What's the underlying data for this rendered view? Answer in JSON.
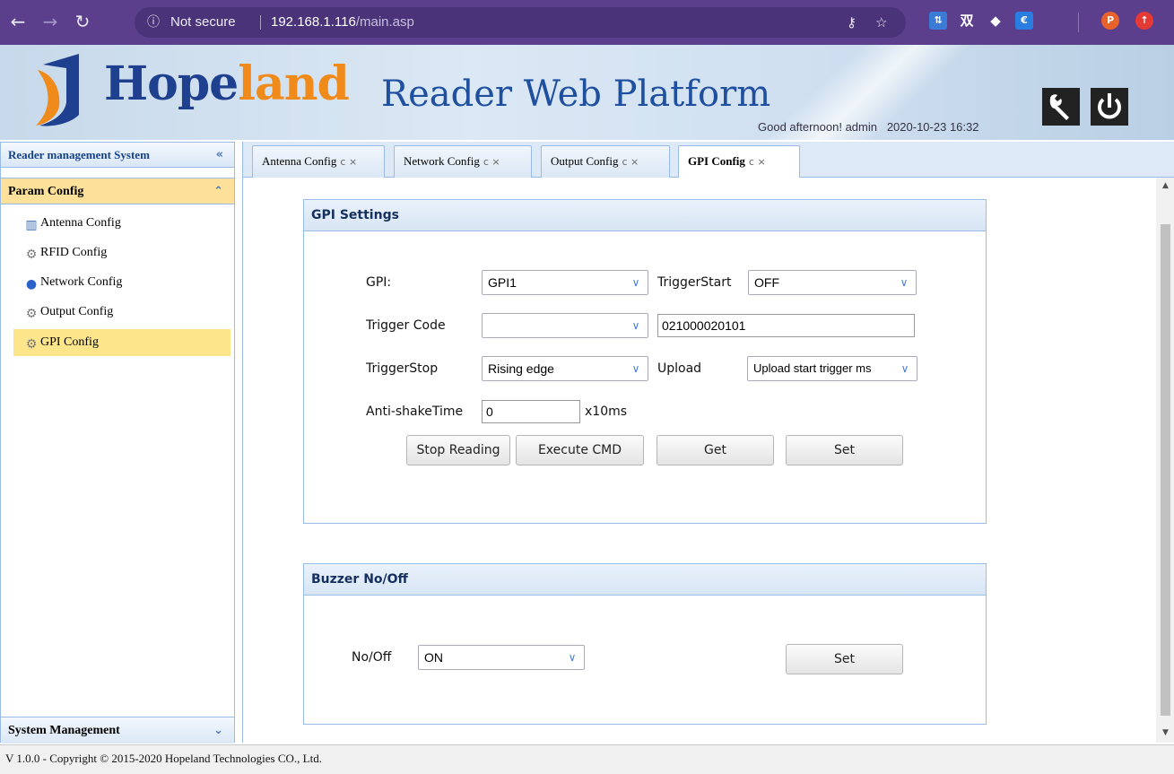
{
  "browser": {
    "info_icon": "ⓘ",
    "security_label": "Not secure",
    "url_host": "192.168.1.116",
    "url_path": "/main.asp",
    "extensions": [
      "P"
    ]
  },
  "header": {
    "logo_part1": "Hope",
    "logo_part2": "land",
    "title": "Reader Web Platform",
    "greeting": "Good afternoon! admin",
    "datetime": "2020-10-23 16:32",
    "settings_icon": "wrench-icon",
    "power_icon": "power-icon"
  },
  "sidebar": {
    "title": "Reader management System",
    "collapse_glyph": "«",
    "section_active": "Param Config",
    "section_active_glyph": "≈",
    "items": [
      {
        "label": "Antenna Config",
        "icon": "antenna-icon"
      },
      {
        "label": "RFID Config",
        "icon": "gear-icon"
      },
      {
        "label": "Network Config",
        "icon": "globe-icon"
      },
      {
        "label": "Output Config",
        "icon": "gear-icon"
      },
      {
        "label": "GPI Config",
        "icon": "gear-icon"
      }
    ],
    "selected_index": 4,
    "section_bottom": "System Management",
    "section_bottom_glyph": "≫"
  },
  "tabs": [
    {
      "label": "Antenna Config"
    },
    {
      "label": "Network Config"
    },
    {
      "label": "Output Config"
    },
    {
      "label": "GPI Config"
    }
  ],
  "tab_controls": "c ×",
  "active_tab": 3,
  "gpi": {
    "title": "GPI Settings",
    "gpi_label": "GPI:",
    "gpi_value": "GPI1",
    "trigger_start_label": "TriggerStart",
    "trigger_start_value": "OFF",
    "trigger_code_label": "Trigger Code",
    "trigger_code_select": "",
    "trigger_code_value": "021000020101",
    "trigger_stop_label": "TriggerStop",
    "trigger_stop_value": "Rising edge",
    "upload_label": "Upload",
    "upload_value": "Upload start trigger ms",
    "antishake_label": "Anti-shakeTime",
    "antishake_value": "0",
    "antishake_unit": "x10ms",
    "btn_stop": "Stop Reading",
    "btn_execute": "Execute CMD",
    "btn_get": "Get",
    "btn_set": "Set"
  },
  "buzzer": {
    "title": "Buzzer No/Off",
    "label": "No/Off",
    "value": "ON",
    "btn_set": "Set"
  },
  "footer": {
    "text": "V 1.0.0 - Copyright © 2015-2020 Hopeland Technologies CO., Ltd."
  },
  "colors": {
    "chrome": "#5b3f8c",
    "accent": "#99bbe8",
    "selected": "#fde58c",
    "brand_blue": "#1f3f8f",
    "brand_orange": "#f08a1a"
  }
}
